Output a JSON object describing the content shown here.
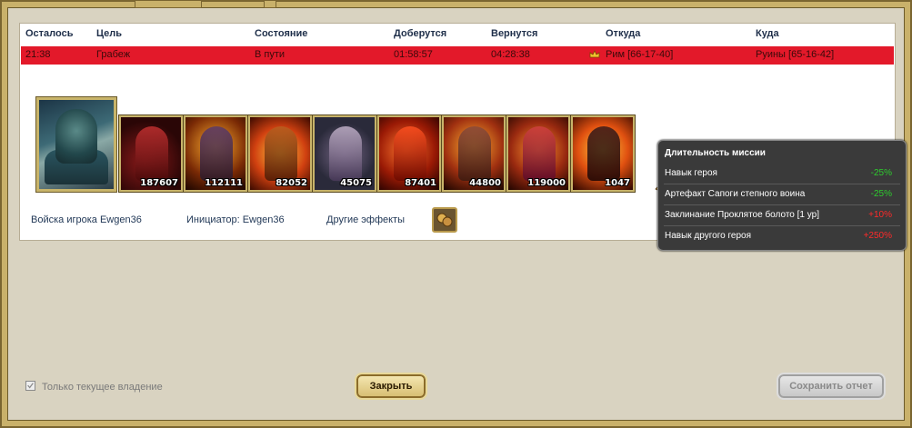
{
  "table": {
    "headers": [
      "Осталось",
      "Цель",
      "Состояние",
      "Доберутся",
      "Вернутся",
      "Откуда",
      "Куда"
    ],
    "row": {
      "remaining": "21:38",
      "goal": "Грабеж",
      "state": "В пути",
      "arrive": "01:58:57",
      "return": "04:28:38",
      "from": "Рим [66-17-40]",
      "to": "Руины [65-16-42]"
    }
  },
  "army": {
    "troop_counts": [
      "187607",
      "112111",
      "82052",
      "45075",
      "87401",
      "44800",
      "119000",
      "1047"
    ],
    "player_label": "Войска игрока Ewgen36",
    "initiator_label": "Инициатор: Ewgen36",
    "effects_label": "Другие эффекты"
  },
  "tooltip": {
    "title": "Длительность миссии",
    "lines": [
      {
        "label": "Навык героя",
        "value": "-25%",
        "color": "#2ecc2e"
      },
      {
        "label": "Артефакт Сапоги степного воина",
        "value": "-25%",
        "color": "#2ecc2e"
      },
      {
        "label": "Заклинание Проклятое болото [1 ур]",
        "value": "+10%",
        "color": "#ff2a2a"
      },
      {
        "label": "Навык другого героя",
        "value": "+250%",
        "color": "#ff2a2a"
      }
    ]
  },
  "footer": {
    "checkbox_label": "Только текущее владение",
    "checkbox_checked": true,
    "close_button": "Закрыть",
    "save_button": "Сохранить отчет"
  },
  "icons": {
    "crown": "crown-icon",
    "army": "army-icon",
    "effects": "effects-icon"
  }
}
